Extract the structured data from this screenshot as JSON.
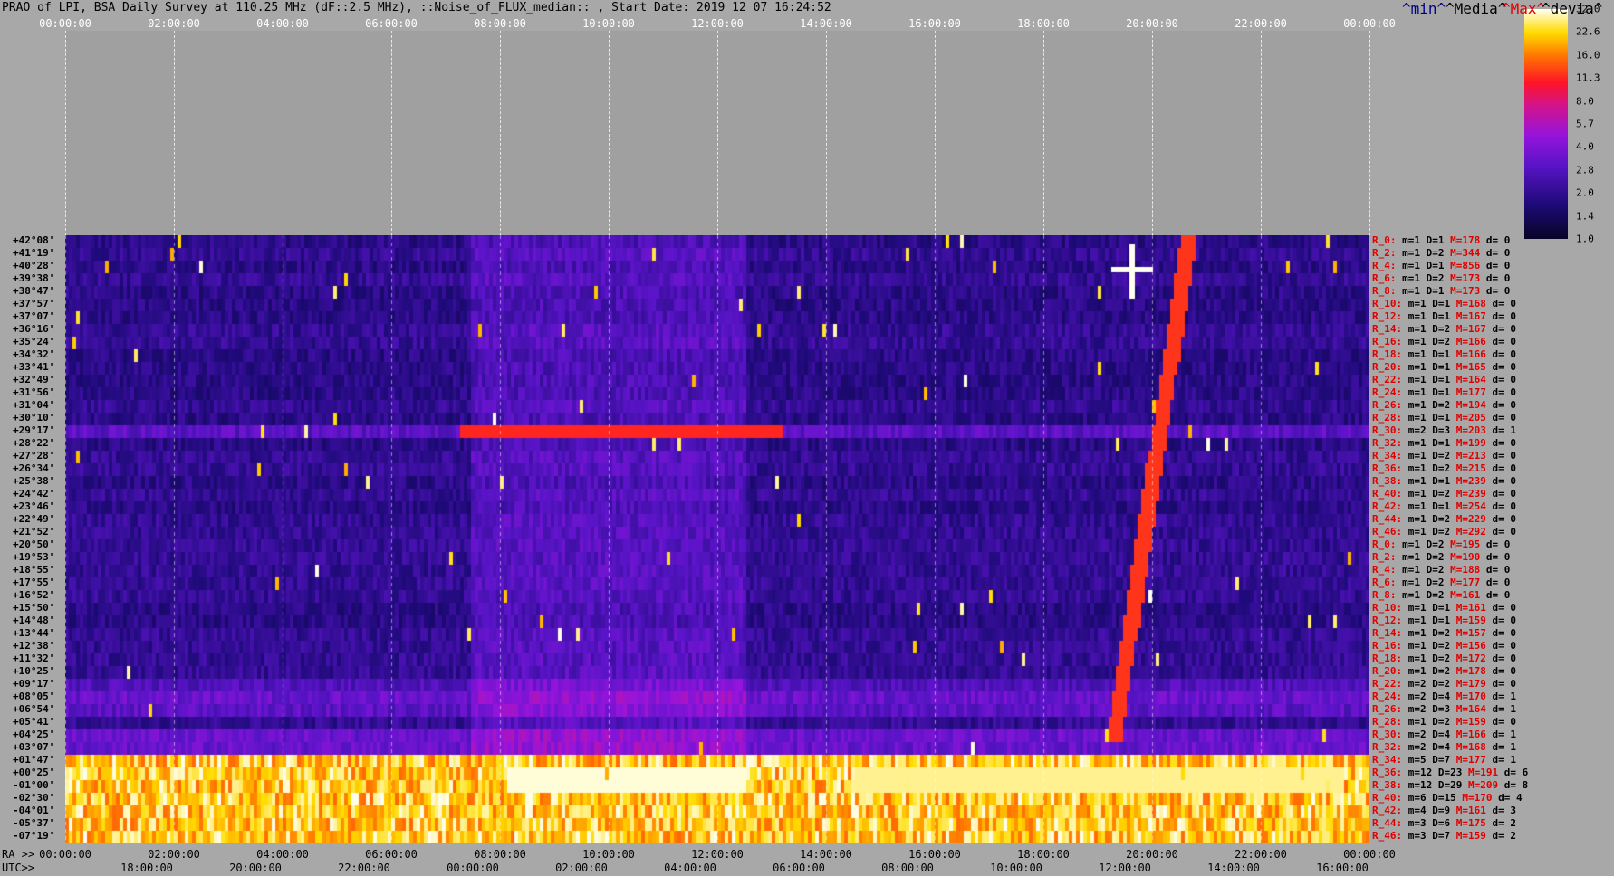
{
  "title": "PRAO of LPI, BSA Daily Survey at 110.25 MHz (dF::2.5 MHz), ::Noise_of_FLUX_median:: , Start Date: 2019 12 07 16:24:52",
  "chart_data": {
    "type": "heatmap",
    "top_ticks": [
      "00:00:00",
      "02:00:00",
      "04:00:00",
      "06:00:00",
      "08:00:00",
      "10:00:00",
      "12:00:00",
      "14:00:00",
      "16:00:00",
      "18:00:00",
      "20:00:00",
      "22:00:00",
      "00:00:00"
    ],
    "ra_label": "RA >>",
    "ra_ticks": [
      "00:00:00",
      "02:00:00",
      "04:00:00",
      "06:00:00",
      "08:00:00",
      "10:00:00",
      "12:00:00",
      "14:00:00",
      "16:00:00",
      "18:00:00",
      "20:00:00",
      "22:00:00",
      "00:00:00"
    ],
    "utc_label": "UTC>>",
    "utc_ticks": [
      "18:00:00",
      "20:00:00",
      "22:00:00",
      "00:00:00",
      "02:00:00",
      "04:00:00",
      "06:00:00",
      "08:00:00",
      "10:00:00",
      "12:00:00",
      "14:00:00",
      "16:00:00"
    ],
    "colorbar": [
      "32.0",
      "22.6",
      "16.0",
      "11.3",
      "8.0",
      "5.7",
      "4.0",
      "2.8",
      "2.0",
      "1.4",
      "1.0"
    ],
    "legend": {
      "min": "^min^",
      "media": "^Media^",
      "max": "^Max^",
      "devia": "^devia^"
    },
    "declinations": [
      "+42°08'",
      "+41°19'",
      "+40°28'",
      "+39°38'",
      "+38°47'",
      "+37°57'",
      "+37°07'",
      "+36°16'",
      "+35°24'",
      "+34°32'",
      "+33°41'",
      "+32°49'",
      "+31°56'",
      "+31°04'",
      "+30°10'",
      "+29°17'",
      "+28°22'",
      "+27°28'",
      "+26°34'",
      "+25°38'",
      "+24°42'",
      "+23°46'",
      "+22°49'",
      "+21°52'",
      "+20°50'",
      "+19°53'",
      "+18°55'",
      "+17°55'",
      "+16°52'",
      "+15°50'",
      "+14°48'",
      "+13°44'",
      "+12°38'",
      "+11°32'",
      "+10°25'",
      "+09°17'",
      "+08°05'",
      "+06°54'",
      "+05°41'",
      "+04°25'",
      "+03°07'",
      "+01°47'",
      "+00°25'",
      "-01°00'",
      "-02°30'",
      "-04°01'",
      "-05°37'",
      "-07°19'"
    ],
    "row_stats": [
      {
        "r": "R_0:",
        "m": "1",
        "d": "1",
        "mx": "178",
        "dv": "0"
      },
      {
        "r": "R_2:",
        "m": "1",
        "d": "2",
        "mx": "344",
        "dv": "0"
      },
      {
        "r": "R_4:",
        "m": "1",
        "d": "1",
        "mx": "856",
        "dv": "0"
      },
      {
        "r": "R_6:",
        "m": "1",
        "d": "2",
        "mx": "173",
        "dv": "0"
      },
      {
        "r": "R_8:",
        "m": "1",
        "d": "1",
        "mx": "173",
        "dv": "0"
      },
      {
        "r": "R_10:",
        "m": "1",
        "d": "1",
        "mx": "168",
        "dv": "0"
      },
      {
        "r": "R_12:",
        "m": "1",
        "d": "1",
        "mx": "167",
        "dv": "0"
      },
      {
        "r": "R_14:",
        "m": "1",
        "d": "2",
        "mx": "167",
        "dv": "0"
      },
      {
        "r": "R_16:",
        "m": "1",
        "d": "2",
        "mx": "166",
        "dv": "0"
      },
      {
        "r": "R_18:",
        "m": "1",
        "d": "1",
        "mx": "166",
        "dv": "0"
      },
      {
        "r": "R_20:",
        "m": "1",
        "d": "1",
        "mx": "165",
        "dv": "0"
      },
      {
        "r": "R_22:",
        "m": "1",
        "d": "1",
        "mx": "164",
        "dv": "0"
      },
      {
        "r": "R_24:",
        "m": "1",
        "d": "1",
        "mx": "177",
        "dv": "0"
      },
      {
        "r": "R_26:",
        "m": "1",
        "d": "2",
        "mx": "194",
        "dv": "0"
      },
      {
        "r": "R_28:",
        "m": "1",
        "d": "1",
        "mx": "205",
        "dv": "0"
      },
      {
        "r": "R_30:",
        "m": "2",
        "d": "3",
        "mx": "203",
        "dv": "1"
      },
      {
        "r": "R_32:",
        "m": "1",
        "d": "1",
        "mx": "199",
        "dv": "0"
      },
      {
        "r": "R_34:",
        "m": "1",
        "d": "2",
        "mx": "213",
        "dv": "0"
      },
      {
        "r": "R_36:",
        "m": "1",
        "d": "2",
        "mx": "215",
        "dv": "0"
      },
      {
        "r": "R_38:",
        "m": "1",
        "d": "1",
        "mx": "239",
        "dv": "0"
      },
      {
        "r": "R_40:",
        "m": "1",
        "d": "2",
        "mx": "239",
        "dv": "0"
      },
      {
        "r": "R_42:",
        "m": "1",
        "d": "1",
        "mx": "254",
        "dv": "0"
      },
      {
        "r": "R_44:",
        "m": "1",
        "d": "2",
        "mx": "229",
        "dv": "0"
      },
      {
        "r": "R_46:",
        "m": "1",
        "d": "2",
        "mx": "292",
        "dv": "0"
      },
      {
        "r": "R_0:",
        "m": "1",
        "d": "2",
        "mx": "195",
        "dv": "0"
      },
      {
        "r": "R_2:",
        "m": "1",
        "d": "2",
        "mx": "190",
        "dv": "0"
      },
      {
        "r": "R_4:",
        "m": "1",
        "d": "2",
        "mx": "188",
        "dv": "0"
      },
      {
        "r": "R_6:",
        "m": "1",
        "d": "2",
        "mx": "177",
        "dv": "0"
      },
      {
        "r": "R_8:",
        "m": "1",
        "d": "2",
        "mx": "161",
        "dv": "0"
      },
      {
        "r": "R_10:",
        "m": "1",
        "d": "1",
        "mx": "161",
        "dv": "0"
      },
      {
        "r": "R_12:",
        "m": "1",
        "d": "1",
        "mx": "159",
        "dv": "0"
      },
      {
        "r": "R_14:",
        "m": "1",
        "d": "2",
        "mx": "157",
        "dv": "0"
      },
      {
        "r": "R_16:",
        "m": "1",
        "d": "2",
        "mx": "156",
        "dv": "0"
      },
      {
        "r": "R_18:",
        "m": "1",
        "d": "2",
        "mx": "172",
        "dv": "0"
      },
      {
        "r": "R_20:",
        "m": "1",
        "d": "2",
        "mx": "178",
        "dv": "0"
      },
      {
        "r": "R_22:",
        "m": "2",
        "d": "2",
        "mx": "179",
        "dv": "0"
      },
      {
        "r": "R_24:",
        "m": "2",
        "d": "4",
        "mx": "170",
        "dv": "1"
      },
      {
        "r": "R_26:",
        "m": "2",
        "d": "3",
        "mx": "164",
        "dv": "1"
      },
      {
        "r": "R_28:",
        "m": "1",
        "d": "2",
        "mx": "159",
        "dv": "0"
      },
      {
        "r": "R_30:",
        "m": "2",
        "d": "4",
        "mx": "166",
        "dv": "1"
      },
      {
        "r": "R_32:",
        "m": "2",
        "d": "4",
        "mx": "168",
        "dv": "1"
      },
      {
        "r": "R_34:",
        "m": "5",
        "d": "7",
        "mx": "177",
        "dv": "1"
      },
      {
        "r": "R_36:",
        "m": "12",
        "d": "23",
        "mx": "191",
        "dv": "6"
      },
      {
        "r": "R_38:",
        "m": "12",
        "d": "29",
        "mx": "209",
        "dv": "8"
      },
      {
        "r": "R_40:",
        "m": "6",
        "d": "15",
        "mx": "170",
        "dv": "4"
      },
      {
        "r": "R_42:",
        "m": "4",
        "d": "9",
        "mx": "161",
        "dv": "3"
      },
      {
        "r": "R_44:",
        "m": "3",
        "d": "6",
        "mx": "175",
        "dv": "2"
      },
      {
        "r": "R_46:",
        "m": "3",
        "d": "7",
        "mx": "159",
        "dv": "2"
      }
    ],
    "colors": {
      "low": "#0a0630",
      "mid": "#7a10d8",
      "high": "#ff2000",
      "peak": "#ffffe8"
    }
  }
}
